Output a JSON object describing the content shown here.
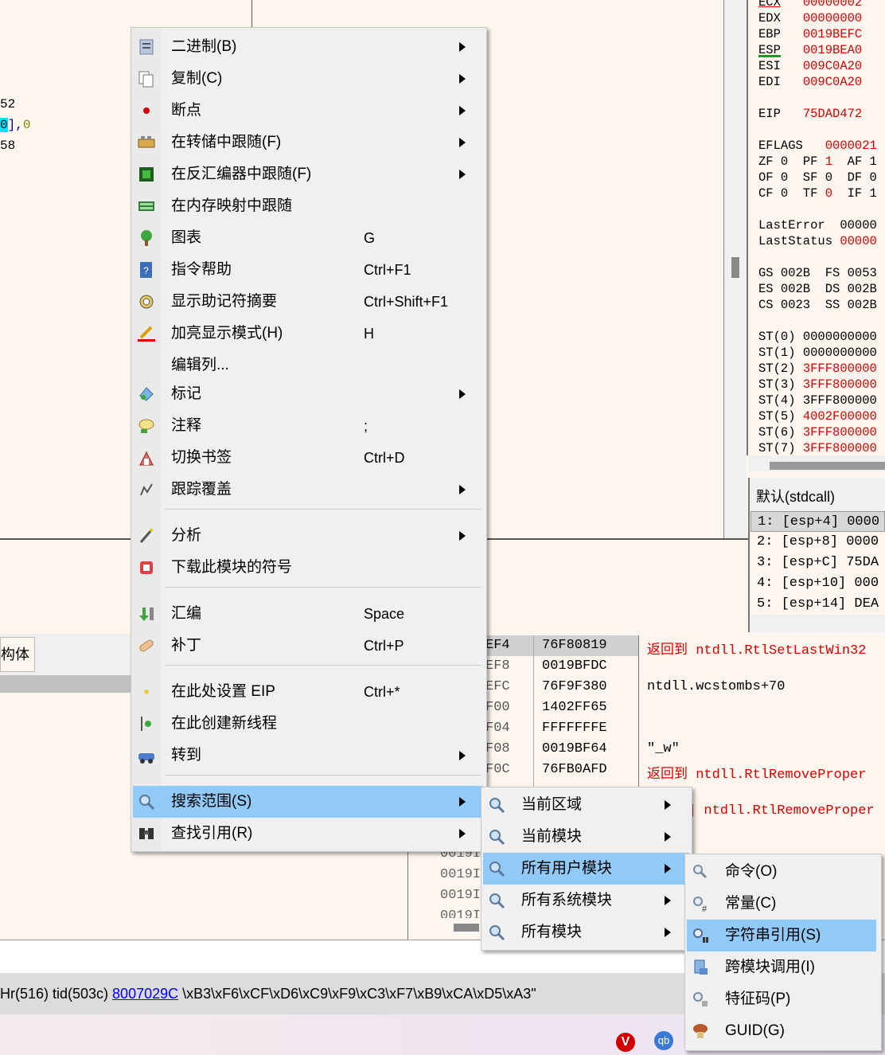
{
  "disasm": {
    "frag_1": "52",
    "frag_2a": "0",
    "frag_2b": "],",
    "frag_2c": "0",
    "frag_3": "58"
  },
  "registers": [
    {
      "name": "ECX",
      "value": "00000002"
    },
    {
      "name": "EDX",
      "value": "00000000"
    },
    {
      "name": "EBP",
      "value": "0019BEFC"
    },
    {
      "name": "ESP",
      "value": "0019BEA0"
    },
    {
      "name": "ESI",
      "value": "009C0A20"
    },
    {
      "name": "EDI",
      "value": "009C0A20"
    },
    {
      "name": "EIP",
      "value": "75DAD472"
    }
  ],
  "eflags": {
    "label": "EFLAGS",
    "value": "0000021",
    "row1": [
      "ZF 0",
      "PF ",
      "1",
      "AF 1"
    ],
    "row2": "OF 0  SF 0  DF 0",
    "row3": [
      "CF 0  TF ",
      "0",
      "  IF 1"
    ]
  },
  "last": {
    "error_label": "LastError",
    "error_value": "00000",
    "status_label": "LastStatus",
    "status_value": "00000"
  },
  "segments": {
    "row1": "GS 002B  FS 0053",
    "row2": "ES 002B  DS 002B",
    "row3": "CS 0023  SS 002B"
  },
  "fpu": [
    {
      "name": "ST(0)",
      "value": "0000000000"
    },
    {
      "name": "ST(1)",
      "value": "0000000000"
    },
    {
      "name": "ST(2)",
      "value": "3FFF800000"
    },
    {
      "name": "ST(3)",
      "value": "3FFF800000"
    },
    {
      "name": "ST(4)",
      "value": "3FFF800000"
    },
    {
      "name": "ST(5)",
      "value": "4002F00000"
    },
    {
      "name": "ST(6)",
      "value": "3FFF800000"
    },
    {
      "name": "ST(7)",
      "value": "3FFF800000"
    }
  ],
  "callconv": {
    "title": "默认(stdcall)",
    "rows": [
      "1: [esp+4] 0000",
      "2: [esp+8] 0000",
      "3: [esp+C] 75DA",
      "4: [esp+10] 000",
      "5: [esp+14] DEA"
    ]
  },
  "tab_struct": "构体",
  "stack": {
    "rows": [
      {
        "addr": "EF4",
        "value": "76F80819",
        "comment_prefix": "返回到 ",
        "comment": "ntdll.RtlSetLastWin32"
      },
      {
        "addr": "EF8",
        "value": "0019BFDC",
        "comment_prefix": "",
        "comment": ""
      },
      {
        "addr": "EFC",
        "value": "76F9F380",
        "comment_prefix": "",
        "comment": "ntdll.wcstombs+70"
      },
      {
        "addr": "F00",
        "value": "1402FF65",
        "comment_prefix": "",
        "comment": ""
      },
      {
        "addr": "F04",
        "value": "FFFFFFFE",
        "comment_prefix": "",
        "comment": ""
      },
      {
        "addr": "F08",
        "value": "0019BF64",
        "comment_prefix": "",
        "comment": "\"_w\""
      },
      {
        "addr": "F0C",
        "value": "76FB0AFD",
        "comment_prefix": "返回到 ",
        "comment": "ntdll.RtlRemoveProper"
      }
    ],
    "hidden_row_suffix": "] ntdll.RtlRemoveProper",
    "dump_addrs": [
      "0019I",
      "0019I",
      "0019I",
      "0019I"
    ]
  },
  "status": {
    "prefix": "Hr(516) tid(503c) ",
    "link": "8007029C",
    "suffix": " \\xB3\\xF6\\xCF\\xD6\\xC9\\xF9\\xC3\\xF7\\xB9\\xCA\\xD5\\xA3\""
  },
  "tray": {
    "vivaldi": "V",
    "qb": "qb"
  },
  "context_menu": [
    {
      "icon": "binary-icon",
      "label": "二进制(B)",
      "shortcut": "",
      "submenu": true
    },
    {
      "icon": "copy-icon",
      "label": "复制(C)",
      "shortcut": "",
      "submenu": true
    },
    {
      "icon": "breakpoint-icon",
      "label": "断点",
      "shortcut": "",
      "submenu": true
    },
    {
      "icon": "dump-follow-icon",
      "label": "在转储中跟随(F)",
      "shortcut": "",
      "submenu": true
    },
    {
      "icon": "disasm-follow-icon",
      "label": "在反汇编器中跟随(F)",
      "shortcut": "",
      "submenu": true
    },
    {
      "icon": "memmap-follow-icon",
      "label": "在内存映射中跟随",
      "shortcut": "",
      "submenu": false
    },
    {
      "icon": "graph-icon",
      "label": "图表",
      "shortcut": "G",
      "submenu": false
    },
    {
      "icon": "help-icon",
      "label": "指令帮助",
      "shortcut": "Ctrl+F1",
      "submenu": false
    },
    {
      "icon": "mnemonic-icon",
      "label": "显示助记符摘要",
      "shortcut": "Ctrl+Shift+F1",
      "submenu": false
    },
    {
      "icon": "highlight-icon",
      "label": "加亮显示模式(H)",
      "shortcut": "H",
      "submenu": false
    },
    {
      "icon": "",
      "label": "编辑列...",
      "shortcut": "",
      "submenu": false
    },
    {
      "icon": "label-icon",
      "label": "标记",
      "shortcut": "",
      "submenu": true
    },
    {
      "icon": "comment-icon",
      "label": "注释",
      "shortcut": ";",
      "submenu": false
    },
    {
      "icon": "bookmark-icon",
      "label": "切换书签",
      "shortcut": "Ctrl+D",
      "submenu": false
    },
    {
      "icon": "trace-icon",
      "label": "跟踪覆盖",
      "shortcut": "",
      "submenu": true
    },
    {
      "icon": "analyze-icon",
      "label": "分析",
      "shortcut": "",
      "submenu": true
    },
    {
      "icon": "download-symbols-icon",
      "label": "下载此模块的符号",
      "shortcut": "",
      "submenu": false
    },
    {
      "icon": "assemble-icon",
      "label": "汇编",
      "shortcut": "Space",
      "submenu": false
    },
    {
      "icon": "patch-icon",
      "label": "补丁",
      "shortcut": "Ctrl+P",
      "submenu": false
    },
    {
      "icon": "set-eip-icon",
      "label": "在此处设置 EIP",
      "shortcut": "Ctrl+*",
      "submenu": false
    },
    {
      "icon": "new-thread-icon",
      "label": "在此创建新线程",
      "shortcut": "",
      "submenu": false
    },
    {
      "icon": "goto-icon",
      "label": "转到",
      "shortcut": "",
      "submenu": true
    },
    {
      "icon": "search-icon",
      "label": "搜索范围(S)",
      "shortcut": "",
      "submenu": true
    },
    {
      "icon": "find-refs-icon",
      "label": "查找引用(R)",
      "shortcut": "",
      "submenu": true
    }
  ],
  "search_submenu": [
    {
      "label": "当前区域",
      "submenu": true
    },
    {
      "label": "当前模块",
      "submenu": true
    },
    {
      "label": "所有用户模块",
      "submenu": true
    },
    {
      "label": "所有系统模块",
      "submenu": true
    },
    {
      "label": "所有模块",
      "submenu": true
    }
  ],
  "usermod_submenu": [
    {
      "icon": "command-search-icon",
      "label": "命令(O)"
    },
    {
      "icon": "constant-search-icon",
      "label": "常量(C)"
    },
    {
      "icon": "string-refs-icon",
      "label": "字符串引用(S)"
    },
    {
      "icon": "intermodular-calls-icon",
      "label": "跨模块调用(I)"
    },
    {
      "icon": "pattern-icon",
      "label": "特征码(P)"
    },
    {
      "icon": "guid-icon",
      "label": "GUID(G)"
    }
  ],
  "colors": {
    "highlight": "#91c9f7",
    "red_text": "#e00000",
    "link": "#0000ee"
  }
}
